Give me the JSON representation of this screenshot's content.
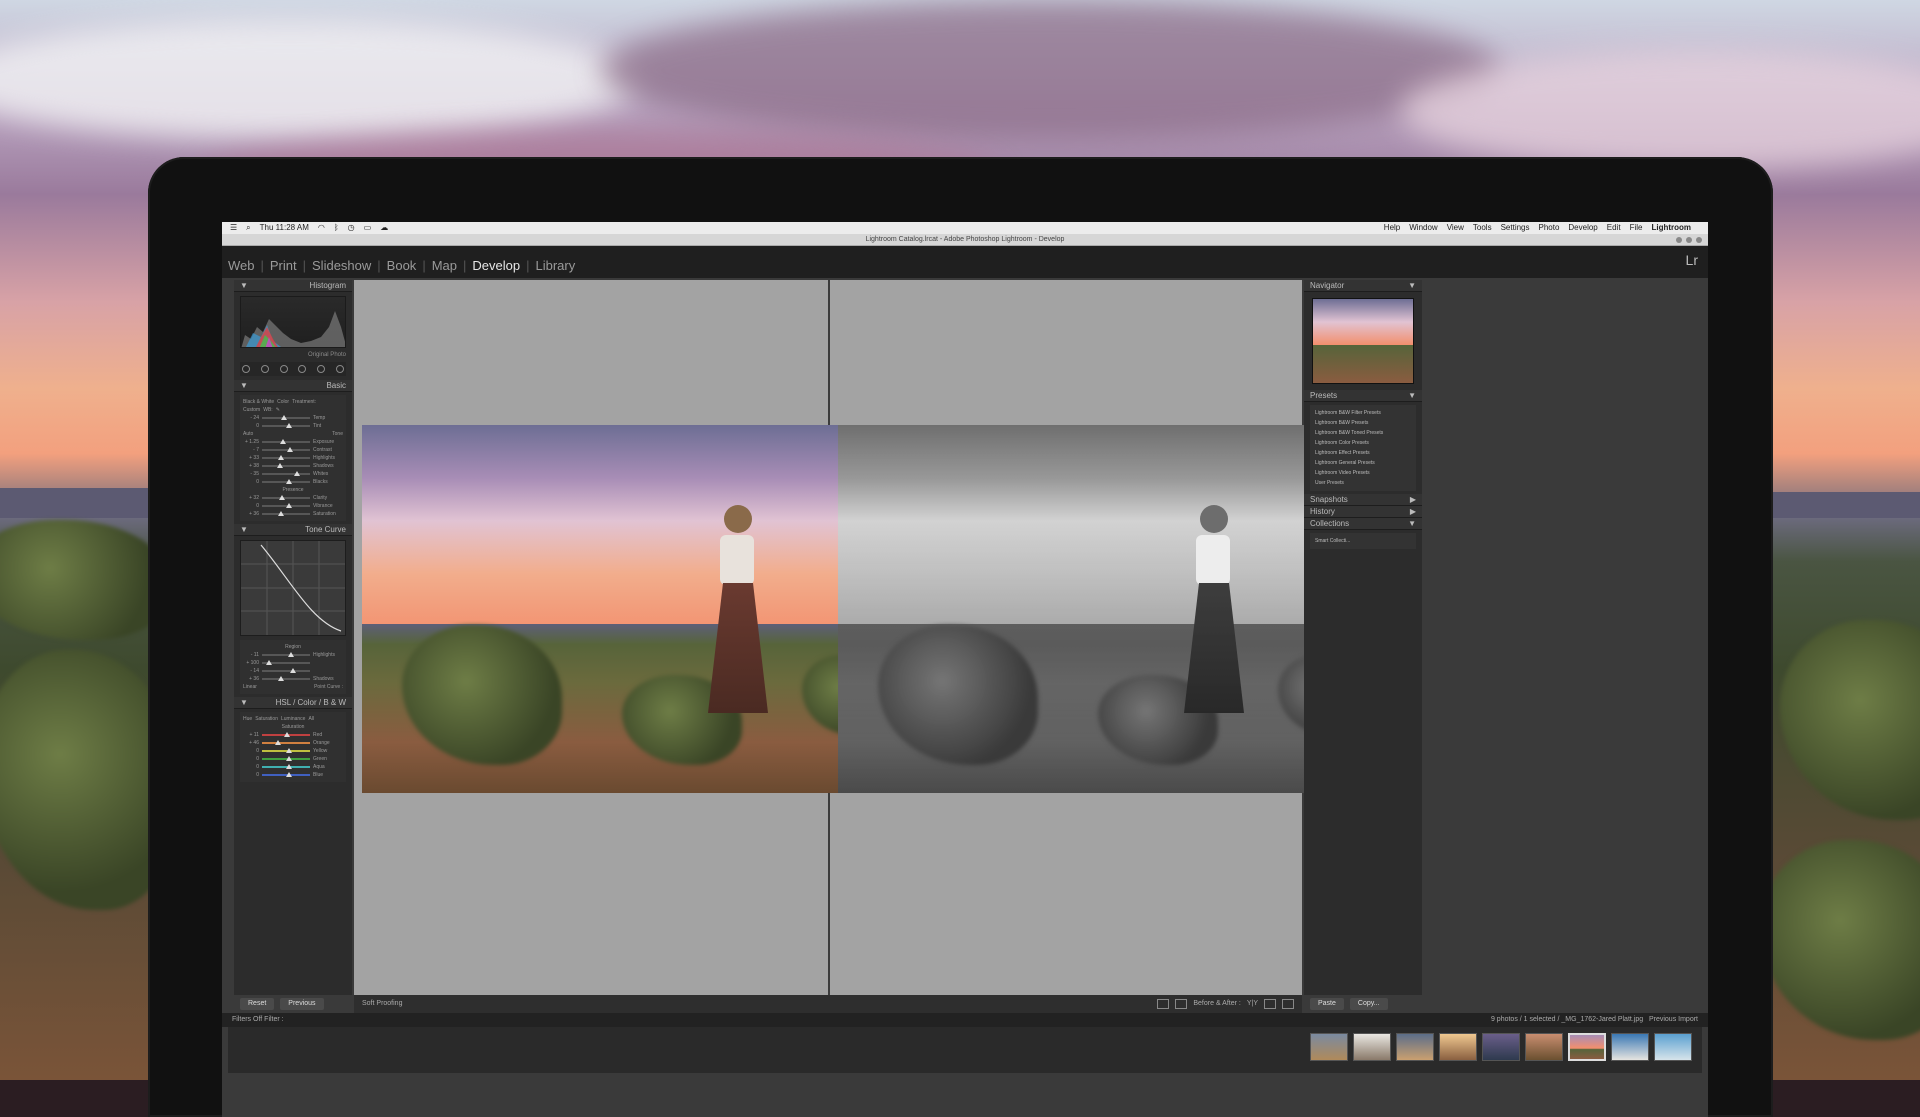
{
  "menubar": {
    "left_items": [
      "Thu 11:28 AM"
    ],
    "right_items": [
      "Lightroom",
      "File",
      "Edit",
      "Develop",
      "Photo",
      "Settings",
      "Tools",
      "View",
      "Window",
      "Help"
    ]
  },
  "window": {
    "title": "Lightroom Catalog.lrcat - Adobe Photoshop Lightroom - Develop"
  },
  "modules": {
    "items": [
      "Library",
      "Develop",
      "Map",
      "Book",
      "Slideshow",
      "Print",
      "Web"
    ],
    "active": "Develop",
    "logo": "Lr"
  },
  "left_panel": {
    "navigator": "Navigator",
    "presets_header": "Presets",
    "presets": [
      "Lightroom B&W Filter Presets",
      "Lightroom B&W Presets",
      "Lightroom B&W Toned Presets",
      "Lightroom Color Presets",
      "Lightroom Effect Presets",
      "Lightroom General Presets",
      "Lightroom Video Presets",
      "User Presets"
    ],
    "snapshots": "Snapshots",
    "history": "History",
    "collections": "Collections",
    "smart_collections": "Smart Collecti...",
    "copy_button": "Copy...",
    "paste_button": "Paste"
  },
  "right_panel": {
    "histogram": "Histogram",
    "original_photo": "Original Photo",
    "basic": "Basic",
    "treatment": "Treatment:",
    "color": "Color",
    "bw": "Black & White",
    "wb": "WB:",
    "wb_value": "Custom",
    "temp_label": "Temp",
    "temp_value": "- 24",
    "tint_label": "Tint",
    "tint_value": "0",
    "tone_label": "Tone",
    "auto_label": "Auto",
    "exposure_label": "Exposure",
    "exposure_value": "+ 1.25",
    "contrast_label": "Contrast",
    "contrast_value": "- 7",
    "highlights_label": "Highlights",
    "highlights_value": "+ 33",
    "shadows_label": "Shadows",
    "shadows_value": "+ 38",
    "whites_label": "Whites",
    "whites_value": "- 35",
    "blacks_label": "Blacks",
    "blacks_value": "0",
    "presence_label": "Presence",
    "clarity_label": "Clarity",
    "clarity_value": "+ 32",
    "vibrance_label": "Vibrance",
    "vibrance_value": "0",
    "saturation_label": "Saturation",
    "saturation_value": "+ 36",
    "tone_curve": "Tone Curve",
    "region_label": "Region",
    "tc_highlights_value": "- 11",
    "tc_lights_value": "+ 100",
    "tc_darks_value": "- 14",
    "tc_shadows_value": "+ 36",
    "point_curve": "Point Curve :",
    "point_curve_value": "Linear",
    "hsl": "HSL",
    "hsl_color": "Color",
    "hsl_bw": "B & W",
    "hue_tab": "Hue",
    "saturation_tab": "Saturation",
    "luminance_tab": "Luminance",
    "all_tab": "All",
    "hsl_saturation_label": "Saturation",
    "hsl_rows": [
      {
        "label": "Red",
        "value": "+ 11"
      },
      {
        "label": "Orange",
        "value": "+ 46"
      },
      {
        "label": "Yellow",
        "value": "0"
      },
      {
        "label": "Green",
        "value": "0"
      },
      {
        "label": "Aqua",
        "value": "0"
      },
      {
        "label": "Blue",
        "value": "0"
      }
    ],
    "previous_button": "Previous",
    "reset_button": "Reset"
  },
  "toolbar": {
    "before_after": "Before & After :",
    "before_after_mode": "Y|Y",
    "soft_proofing": "Soft Proofing"
  },
  "filmstrip": {
    "previous_import": "Previous Import",
    "status": "9 photos / 1 selected / _MG_1762-Jared Platt.jpg",
    "filter_label": "Filter :",
    "filter_value": "Filters Off"
  },
  "colors": {
    "accent": "#e6e6e6",
    "panel_bg": "#2c2c2c",
    "viewer_bg": "#a3a3a3"
  }
}
